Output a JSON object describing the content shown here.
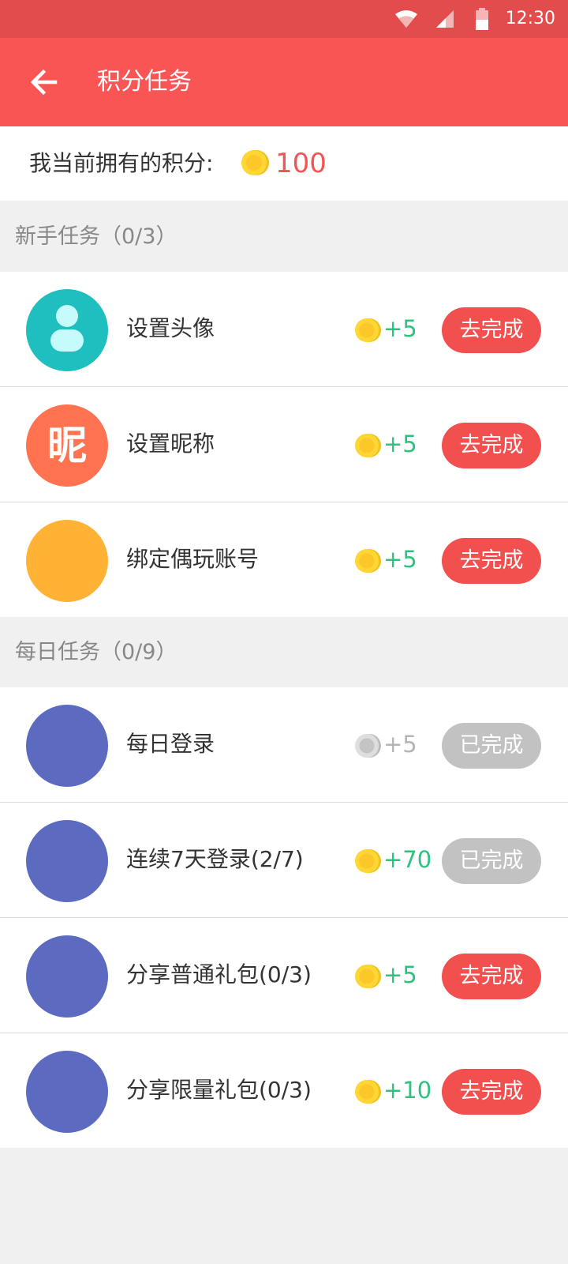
{
  "status_bar": {
    "time": "12:30",
    "icons": [
      "wifi-icon",
      "cell-signal-icon",
      "battery-icon"
    ]
  },
  "app_bar": {
    "back_icon": "arrow-left-icon",
    "title": "积分任务"
  },
  "points": {
    "label": "我当前拥有的积分:",
    "value": "100",
    "icon": "coin-icon"
  },
  "sections": [
    {
      "title": "新手任务（0/3）",
      "tasks": [
        {
          "name": "设置头像",
          "reward": "+5",
          "button": "去完成",
          "done": false,
          "avatar_color": "#20bfbf",
          "icon": "user-icon",
          "glyph": ""
        },
        {
          "name": "设置昵称",
          "reward": "+5",
          "button": "去完成",
          "done": false,
          "avatar_color": "#ff7350",
          "icon": "nickname-icon",
          "glyph": "昵"
        },
        {
          "name": "绑定偶玩账号",
          "reward": "+5",
          "button": "去完成",
          "done": false,
          "avatar_color": "#ffb233",
          "icon": "bind-account-icon",
          "glyph": ""
        }
      ]
    },
    {
      "title": "每日任务（0/9）",
      "tasks": [
        {
          "name": "每日登录",
          "reward": "+5",
          "button": "已完成",
          "done": true,
          "avatar_color": "#5c6bc0",
          "icon": "daily-login-icon",
          "glyph": ""
        },
        {
          "name": "连续7天登录(2/7)",
          "reward": "+70",
          "button": "已完成",
          "done": true,
          "coin_active": true,
          "avatar_color": "#5c6bc0",
          "icon": "streak-login-icon",
          "glyph": ""
        },
        {
          "name": "分享普通礼包(0/3)",
          "reward": "+5",
          "button": "去完成",
          "done": false,
          "avatar_color": "#5c6bc0",
          "icon": "share-gift-icon",
          "glyph": ""
        },
        {
          "name": "分享限量礼包(0/3)",
          "reward": "+10",
          "button": "去完成",
          "done": false,
          "avatar_color": "#5c6bc0",
          "icon": "share-limited-gift-icon",
          "glyph": ""
        }
      ]
    }
  ],
  "colors": {
    "primary": "#fa5555",
    "status_bar": "#e34c4c",
    "reward_green": "#2cc37e",
    "done_gray": "#c2c2c2",
    "coin_gold": "#ffd633"
  }
}
